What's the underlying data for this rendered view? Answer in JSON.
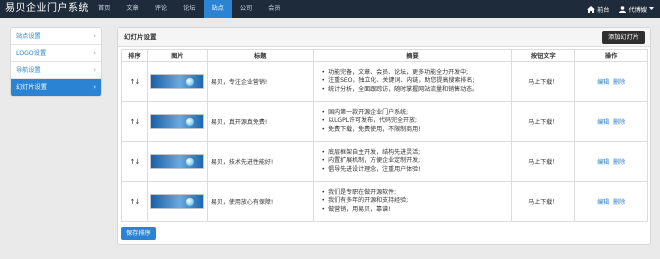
{
  "brand": "易贝企业门户系统",
  "topnav": [
    "首页",
    "文章",
    "评论",
    "论坛",
    "站点",
    "公司",
    "会员"
  ],
  "topright": {
    "home": "前台",
    "user": "代博嫂"
  },
  "sidebar": [
    {
      "label": "站点设置"
    },
    {
      "label": "LOGO设置"
    },
    {
      "label": "导航设置"
    },
    {
      "label": "幻灯片设置"
    }
  ],
  "panel": {
    "title": "幻灯片设置",
    "add_label": "添加幻灯片",
    "save_label": "保存排序"
  },
  "table": {
    "headers": [
      "排序",
      "图片",
      "标题",
      "摘要",
      "按钮文字",
      "操作"
    ],
    "rows": [
      {
        "sort": "↑↓",
        "title": "易贝，专注企业营销!",
        "summary": [
          "功能完备，文章、会员、论坛，更多功能全力开发中;",
          "注重SEO，独立化、关键词、内链，助您提高搜索排名;",
          "统计分析，全面跟踪访，随时掌握网站流量和销售动态。"
        ],
        "button_text": "马上下载！",
        "edit": "编辑",
        "delete": "删除"
      },
      {
        "sort": "↑↓",
        "title": "易贝，真开源真免费!",
        "summary": [
          "国内第一款开源企业门户系统;",
          "以LGPL许可发布，代码完全开放;",
          "免费下载，免费使用，不限制商用!"
        ],
        "button_text": "马上下载！",
        "edit": "编辑",
        "delete": "删除"
      },
      {
        "sort": "↑↓",
        "title": "易贝，技术先进性能好!",
        "summary": [
          "底层框架自主开发，结构先进灵活;",
          "内置扩展机制，方便企业定制开发;",
          "倡导先进设计理念，注重用户体验!"
        ],
        "button_text": "马上下载！",
        "edit": "编辑",
        "delete": "删除"
      },
      {
        "sort": "↑↓",
        "title": "易贝，使用放心有保障!",
        "summary": [
          "我们是专职在做开源软件;",
          "我们有多年的开源和支持经验;",
          "做营销，用易贝，靠谱!"
        ],
        "button_text": "马上下载！",
        "edit": "编辑",
        "delete": "删除"
      }
    ]
  },
  "colors": {
    "navbar": "#1d2b3a",
    "accent": "#2b84d3",
    "link": "#2a7fc8"
  }
}
